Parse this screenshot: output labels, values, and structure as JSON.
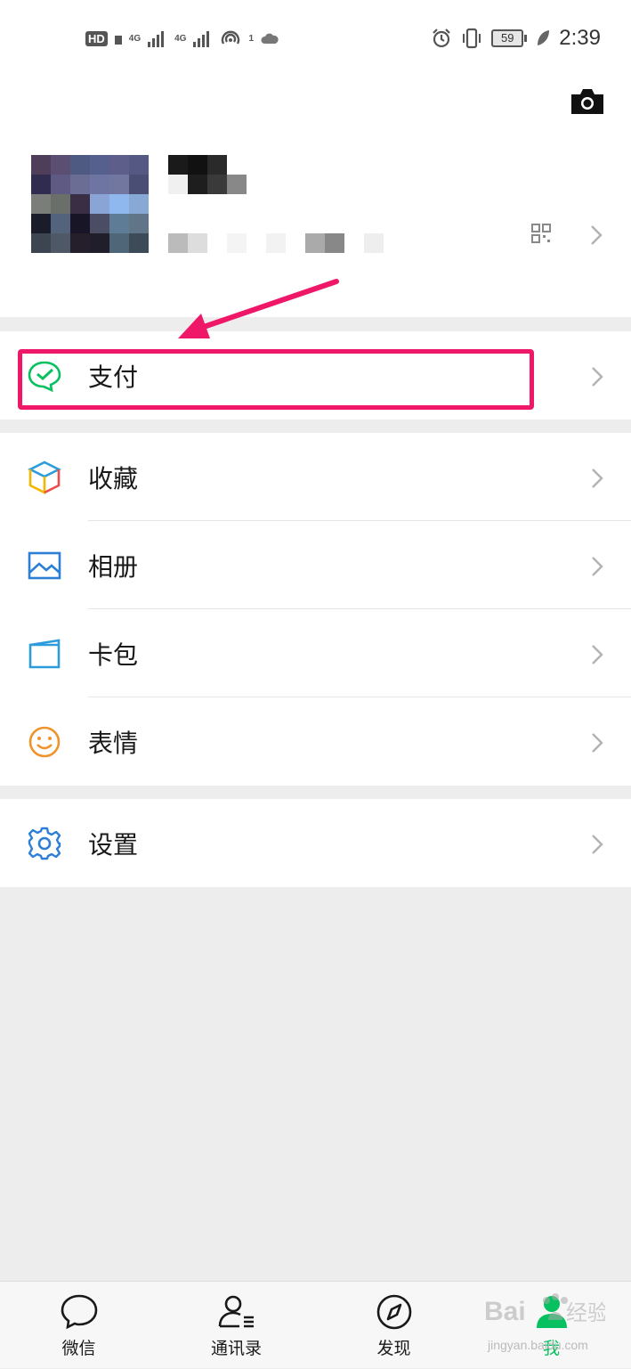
{
  "status_bar": {
    "hd": "HD",
    "sim1": "4G",
    "sim2": "4G",
    "hotspot_count": "1",
    "battery": "59",
    "time": "2:39"
  },
  "profile": {
    "camera_icon": "camera-icon",
    "qr_icon": "qr-code-icon"
  },
  "menu": {
    "pay": {
      "label": "支付",
      "icon": "wechat-pay-icon",
      "color": "#07c160"
    },
    "items": [
      {
        "label": "收藏",
        "icon": "favorites-cube-icon"
      },
      {
        "label": "相册",
        "icon": "album-icon"
      },
      {
        "label": "卡包",
        "icon": "card-wallet-icon"
      },
      {
        "label": "表情",
        "icon": "emoji-smile-icon"
      }
    ],
    "settings": {
      "label": "设置",
      "icon": "gear-icon"
    }
  },
  "annotation": {
    "highlight_color": "#ef1768"
  },
  "tabbar": {
    "tabs": [
      {
        "label": "微信",
        "icon": "chat-bubble-icon"
      },
      {
        "label": "通讯录",
        "icon": "contacts-icon"
      },
      {
        "label": "发现",
        "icon": "compass-icon"
      },
      {
        "label": "我",
        "icon": "person-icon",
        "active": true
      }
    ],
    "active_color": "#07c160"
  },
  "watermark": {
    "text": "jingyan.baidu.com"
  }
}
